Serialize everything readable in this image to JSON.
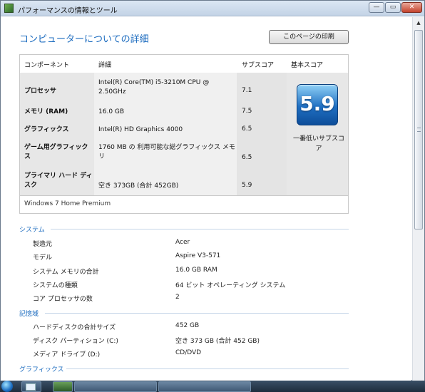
{
  "window": {
    "title": "パフォーマンスの情報とツール",
    "min_glyph": "—",
    "max_glyph": "▭",
    "close_glyph": "✕"
  },
  "main": {
    "heading": "コンピューターについての詳細",
    "print_button": "このページの印刷"
  },
  "score_table": {
    "headers": {
      "component": "コンポーネント",
      "detail": "詳細",
      "subscore": "サブスコア",
      "base": "基本スコア"
    },
    "rows": [
      {
        "component": "プロセッサ",
        "detail": "Intel(R) Core(TM) i5-3210M CPU @ 2.50GHz",
        "subscore": "7.1"
      },
      {
        "component": "メモリ (RAM)",
        "detail": "16.0 GB",
        "subscore": "7.5"
      },
      {
        "component": "グラフィックス",
        "detail": "Intel(R) HD Graphics 4000",
        "subscore": "6.5"
      },
      {
        "component": "ゲーム用グラフィックス",
        "detail": "1760 MB の 利用可能な総グラフィックス メモリ",
        "subscore": "6.5"
      },
      {
        "component": "プライマリ ハード ディスク",
        "detail": "空き 373GB (合計 452GB)",
        "subscore": "5.9"
      }
    ],
    "base_score": "5.9",
    "base_label": "一番低いサブスコア",
    "os": "Windows 7 Home Premium"
  },
  "system": {
    "title": "システム",
    "items": [
      {
        "label": "製造元",
        "value": "Acer"
      },
      {
        "label": "モデル",
        "value": "Aspire V3-571"
      },
      {
        "label": "システム メモリの合計",
        "value": "16.0 GB RAM"
      },
      {
        "label": "システムの種類",
        "value": "64 ビット オペレーティング システム"
      },
      {
        "label": "コア プロセッサの数",
        "value": "2"
      }
    ]
  },
  "storage": {
    "title": "記憶域",
    "items": [
      {
        "label": "ハードディスクの合計サイズ",
        "value": "452 GB"
      },
      {
        "label": "ディスク パーティション (C:)",
        "value": "空き 373 GB (合計 452 GB)"
      },
      {
        "label": "メディア ドライブ (D:)",
        "value": "CD/DVD"
      }
    ]
  },
  "graphics": {
    "title": "グラフィックス"
  },
  "icons": {
    "app": "performance-tools-icon",
    "scroll_up": "▲",
    "start": "windows-start-icon"
  }
}
